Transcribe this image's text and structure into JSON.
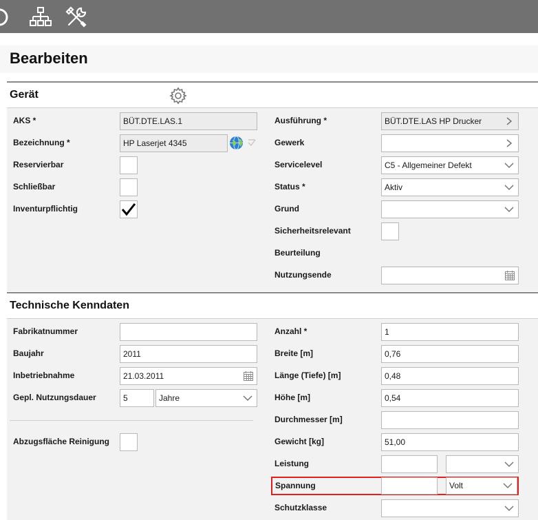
{
  "toolbar": {
    "icons": [
      "partial-circle-icon",
      "network-tree-icon",
      "tools-icon"
    ]
  },
  "page": {
    "title": "Bearbeiten"
  },
  "geraet": {
    "title": "Gerät",
    "aks_label": "AKS *",
    "aks_value": "BÜT.DTE.LAS.1",
    "bezeichnung_label": "Bezeichnung *",
    "bezeichnung_value": "HP Laserjet 4345",
    "reservierbar_label": "Reservierbar",
    "reservierbar_checked": false,
    "schliessbar_label": "Schließbar",
    "schliessbar_checked": false,
    "inventur_label": "Inventurpflichtig",
    "inventur_checked": true,
    "ausfuehrung_label": "Ausführung *",
    "ausfuehrung_value": "BÜT.DTE.LAS HP Drucker",
    "gewerk_label": "Gewerk",
    "gewerk_value": "",
    "servicelevel_label": "Servicelevel",
    "servicelevel_value": "C5 - Allgemeiner Defekt",
    "status_label": "Status *",
    "status_value": "Aktiv",
    "grund_label": "Grund",
    "grund_value": "",
    "sicherheit_label": "Sicherheitsrelevant",
    "sicherheit_checked": false,
    "beurteilung_label": "Beurteilung",
    "nutzungsende_label": "Nutzungsende",
    "nutzungsende_value": ""
  },
  "technik": {
    "title": "Technische Kenndaten",
    "fabrikat_label": "Fabrikatnummer",
    "fabrikat_value": "",
    "baujahr_label": "Baujahr",
    "baujahr_value": "2011",
    "inbetrieb_label": "Inbetriebnahme",
    "inbetrieb_value": "21.03.2011",
    "nutzdauer_label": "Gepl. Nutzungsdauer",
    "nutzdauer_value": "5",
    "nutzdauer_unit": "Jahre",
    "abzug_label": "Abzugsfläche Reinigung",
    "abzug_checked": false,
    "anzahl_label": "Anzahl *",
    "anzahl_value": "1",
    "breite_label": "Breite [m]",
    "breite_value": "0,76",
    "laenge_label": "Länge (Tiefe) [m]",
    "laenge_value": "0,48",
    "hoehe_label": "Höhe [m]",
    "hoehe_value": "0,54",
    "durchmesser_label": "Durchmesser [m]",
    "durchmesser_value": "",
    "gewicht_label": "Gewicht [kg]",
    "gewicht_value": "51,00",
    "leistung_label": "Leistung",
    "leistung_value": "",
    "leistung_unit": "",
    "spannung_label": "Spannung",
    "spannung_value": "",
    "spannung_unit": "Volt",
    "schutz_label": "Schutzklasse",
    "schutz_value": ""
  },
  "colors": {
    "toolbar": "#717171",
    "panel": "#f2f2f2",
    "highlight": "#e02020",
    "globe": "#2a7fd4"
  }
}
